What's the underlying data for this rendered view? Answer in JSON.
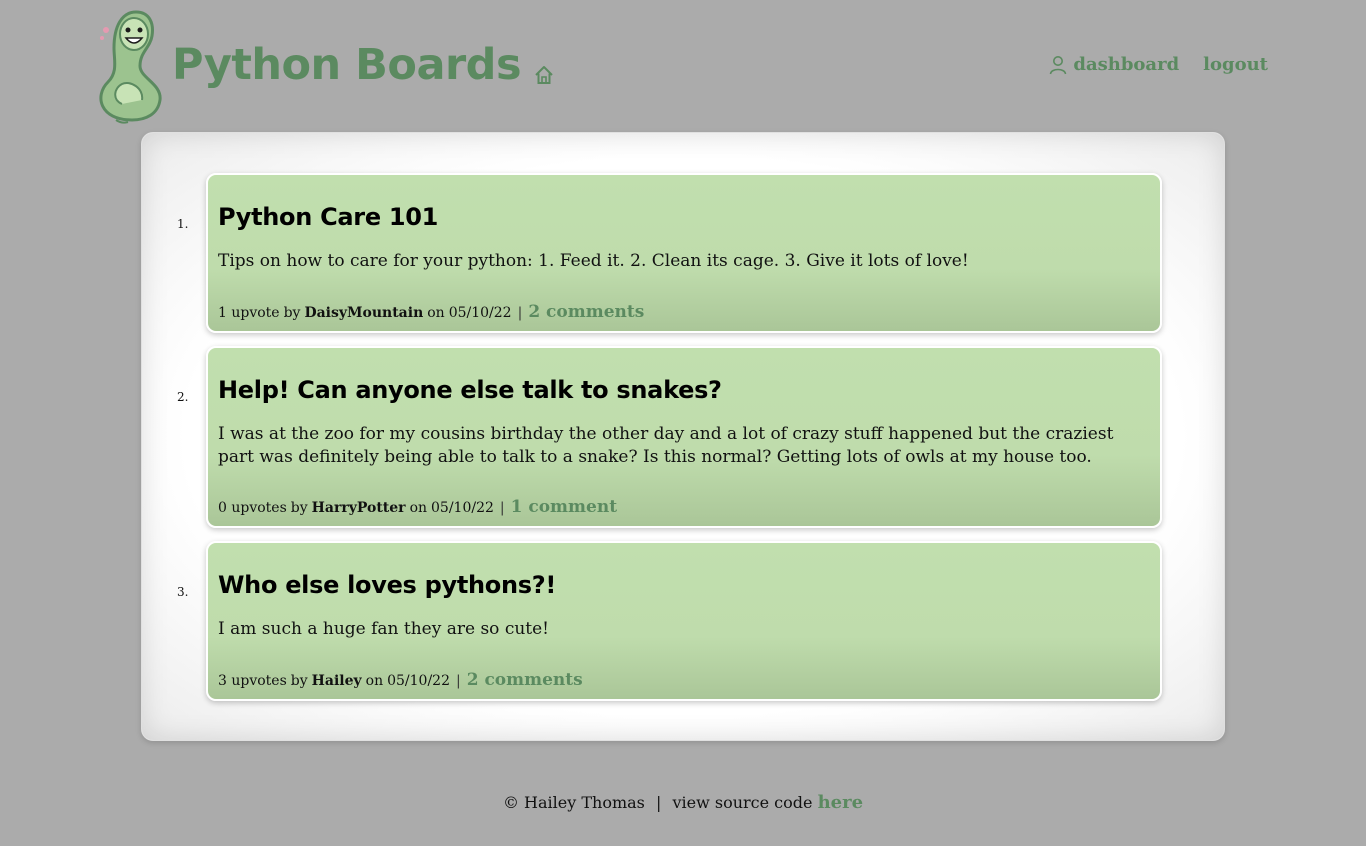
{
  "header": {
    "brand": "Python Boards",
    "nav": {
      "dashboard": "dashboard",
      "logout": "logout"
    }
  },
  "posts": [
    {
      "number": "1.",
      "title": "Python Care 101",
      "body": "Tips on how to care for your python: 1. Feed it. 2. Clean its cage. 3. Give it lots of love!",
      "votes": "1 upvote",
      "by": "by",
      "author": "DaisyMountain",
      "on": "on",
      "date": "05/10/22",
      "sep": "|",
      "comments": "2 comments"
    },
    {
      "number": "2.",
      "title": "Help! Can anyone else talk to snakes?",
      "body": "I was at the zoo for my cousins birthday the other day and a lot of crazy stuff happened but the craziest part was definitely being able to talk to a snake? Is this normal? Getting lots of owls at my house too.",
      "votes": "0 upvotes",
      "by": "by",
      "author": "HarryPotter",
      "on": "on",
      "date": "05/10/22",
      "sep": "|",
      "comments": "1 comment"
    },
    {
      "number": "3.",
      "title": "Who else loves pythons?!",
      "body": "I am such a huge fan they are so cute!",
      "votes": "3 upvotes",
      "by": "by",
      "author": "Hailey",
      "on": "on",
      "date": "05/10/22",
      "sep": "|",
      "comments": "2 comments"
    }
  ],
  "footer": {
    "copyright": "© Hailey Thomas",
    "sep": "|",
    "source_text": "view source code",
    "source_link": "here"
  },
  "colors": {
    "background": "#ababab",
    "accent": "#5b8a60",
    "card_green": "#c1dfae",
    "panel": "#ffffff"
  },
  "icons": {
    "logo": "snake-mascot-icon",
    "home": "home-icon",
    "user": "user-icon"
  }
}
